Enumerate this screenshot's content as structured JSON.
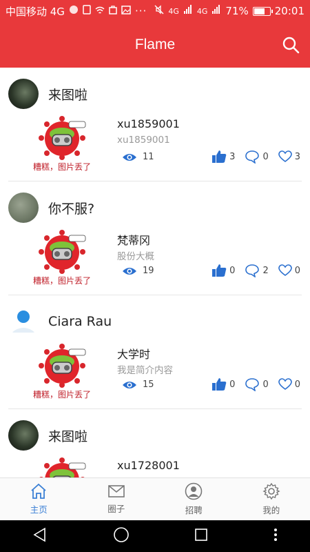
{
  "status_bar": {
    "carrier": "中国移动 4G",
    "network_left": "4G",
    "network_right": "4G",
    "battery": "71%",
    "battery_level": 0.71,
    "time": "20:01"
  },
  "header": {
    "title": "Flame"
  },
  "posts": [
    {
      "author": "来图啦",
      "title": "xu1859001",
      "subtitle": "xu1859001",
      "image_caption": "糟糕，图片丢了",
      "views": "11",
      "likes": "3",
      "comments": "0",
      "favorites": "3"
    },
    {
      "author": "你不服?",
      "title": "梵蒂冈",
      "subtitle": "股份大概",
      "image_caption": "糟糕，图片丢了",
      "views": "19",
      "likes": "0",
      "comments": "2",
      "favorites": "0"
    },
    {
      "author": "Ciara Rau",
      "title": "大学时",
      "subtitle": "我是简介内容",
      "image_caption": "糟糕，图片丢了",
      "views": "15",
      "likes": "0",
      "comments": "0",
      "favorites": "0"
    },
    {
      "author": "来图啦",
      "title": "xu1728001",
      "subtitle": "",
      "image_caption": "",
      "views": "",
      "likes": "",
      "comments": "",
      "favorites": ""
    }
  ],
  "tabs": [
    {
      "label": "主页",
      "icon": "home-icon",
      "active": true
    },
    {
      "label": "圈子",
      "icon": "mail-icon",
      "active": false
    },
    {
      "label": "招聘",
      "icon": "person-icon",
      "active": false
    },
    {
      "label": "我的",
      "icon": "gear-icon",
      "active": false
    }
  ],
  "colors": {
    "brand": "#e8393b",
    "accent": "#3a7fd5",
    "error_text": "#c0202a"
  }
}
